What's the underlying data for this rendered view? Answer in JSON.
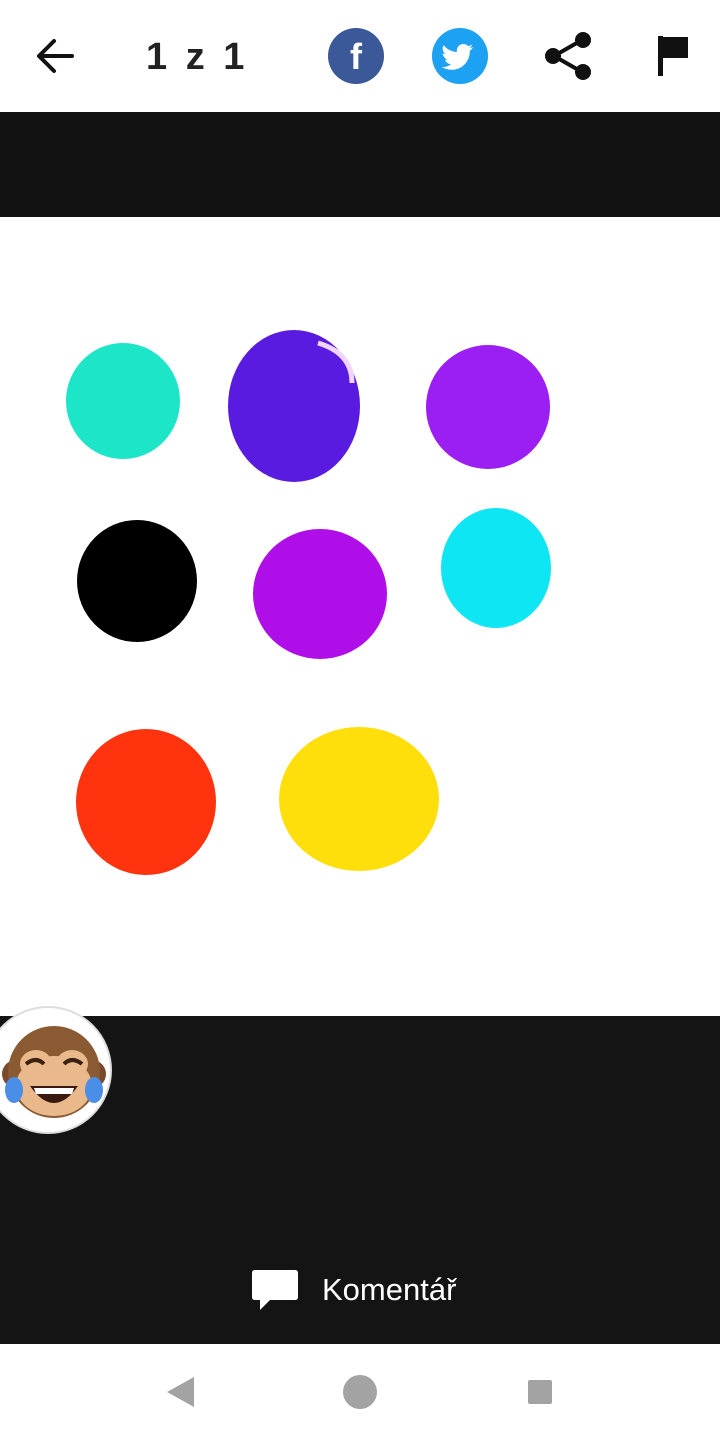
{
  "header": {
    "counter": "1 z 1",
    "icons": [
      "arrow-left-icon",
      "facebook-icon",
      "twitter-icon",
      "share-icon",
      "flag-icon"
    ],
    "colors": {
      "facebook": "#3b5998",
      "twitter": "#1da1f2",
      "icon": "#111111"
    }
  },
  "image": {
    "background": "#ffffff",
    "blob_colors": [
      "#1de6c8",
      "#5a1be0",
      "#9b1ef2",
      "#000000",
      "#b00ee8",
      "#0fe6f4",
      "#ff330e",
      "#ffdf0b"
    ]
  },
  "bottom": {
    "reaction_icon": "laughing-monkey-emoji-icon",
    "comment_label": "Komentář",
    "background": "#141414"
  },
  "navbar": {
    "icons": [
      "nav-back-icon",
      "nav-home-icon",
      "nav-recent-icon"
    ]
  }
}
